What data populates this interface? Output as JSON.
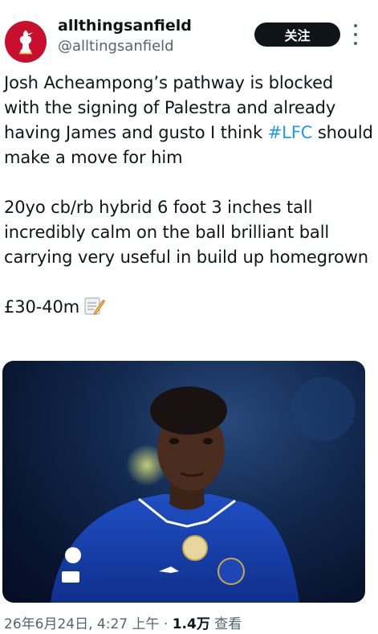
{
  "author": {
    "display_name": "allthingsanfield",
    "handle": "@alltingsanfield",
    "avatar_icon": "liverbird-icon"
  },
  "follow_label": "关注",
  "more_icon": "more-vertical-icon",
  "tweet": {
    "line1_pre": "Josh Acheampong’s pathway is blocked with the signing of Palestra and already having James and gusto I think ",
    "hashtag": "#LFC",
    "line1_post": " should make a move for him",
    "para2": "20yo cb/rb hybrid 6 foot 3 inches tall incredibly calm on the ball brilliant ball carrying very useful in build up homegrown",
    "price": "£30-40m",
    "price_icon": "memo-icon"
  },
  "media": {
    "icon": "player-photo"
  },
  "meta": {
    "date": "26年6月24日",
    "time": "4:27 上午",
    "separator": "·",
    "views_count": "1.4万",
    "views_label": "查看"
  },
  "colors": {
    "avatar_bg": "#c8102e",
    "follow_bg": "#0f1419",
    "hashtag": "#1d9bf0",
    "secondary_text": "#536471"
  }
}
